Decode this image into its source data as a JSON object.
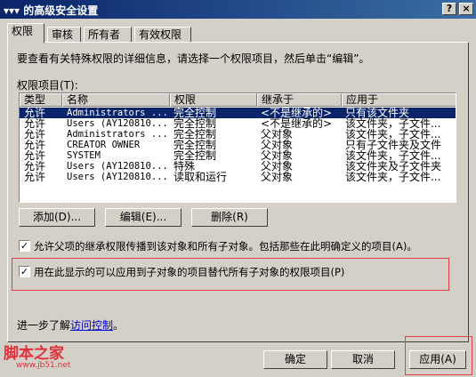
{
  "window": {
    "title": "▾▾▾ 的高级安全设置",
    "help_glyph": "?",
    "close_glyph": "×"
  },
  "tabs": [
    {
      "label": "权限"
    },
    {
      "label": "审核"
    },
    {
      "label": "所有者"
    },
    {
      "label": "有效权限"
    }
  ],
  "instructions": "要查看有关特殊权限的详细信息，请选择一个权限项目，然后单击“编辑”。",
  "permission_list_label": "权限项目(T):",
  "columns": [
    "类型",
    "名称",
    "权限",
    "继承于",
    "应用于"
  ],
  "rows": [
    {
      "type": "允许",
      "name": "Administrators ...",
      "perm": "完全控制",
      "inherit": "<不是继承的>",
      "apply": "只有该文件夹",
      "selected": true
    },
    {
      "type": "允许",
      "name": "Users (AY120810...",
      "perm": "完全控制",
      "inherit": "<不是继承的>",
      "apply": "该文件夹，子文件..."
    },
    {
      "type": "允许",
      "name": "Administrators ...",
      "perm": "完全控制",
      "inherit": "父对象",
      "apply": "该文件夹，子文件..."
    },
    {
      "type": "允许",
      "name": "CREATOR OWNER",
      "perm": "完全控制",
      "inherit": "父对象",
      "apply": "只有子文件夹及文件"
    },
    {
      "type": "允许",
      "name": "SYSTEM",
      "perm": "完全控制",
      "inherit": "父对象",
      "apply": "该文件夹，子文件..."
    },
    {
      "type": "允许",
      "name": "Users (AY120810...",
      "perm": "特殊",
      "inherit": "父对象",
      "apply": "该文件夹及子文件夹"
    },
    {
      "type": "允许",
      "name": "Users (AY120810...",
      "perm": "读取和运行",
      "inherit": "父对象",
      "apply": "该文件夹，子文件..."
    }
  ],
  "buttons": {
    "add": "添加(D)...",
    "edit": "编辑(E)...",
    "remove": "删除(R)"
  },
  "options": {
    "inherit_label": "允许父项的继承权限传播到该对象和所有子对象。包括那些在此明确定义的项目(A)。",
    "inherit_checked": true,
    "replace_label": "用在此显示的可以应用到子对象的项目替代所有子对象的权限项目(P)",
    "replace_checked": true
  },
  "learn_more": {
    "prefix": "进一步了解",
    "link": "访问控制",
    "suffix": "。"
  },
  "footer": {
    "ok": "确定",
    "cancel": "取消",
    "apply": "应用(A)"
  },
  "watermark": {
    "brand": "脚本之家",
    "url": "www.jb51.net"
  },
  "colors": {
    "selection": "#0a246a",
    "annotation": "#e04040",
    "watermark": "#e0303a"
  }
}
